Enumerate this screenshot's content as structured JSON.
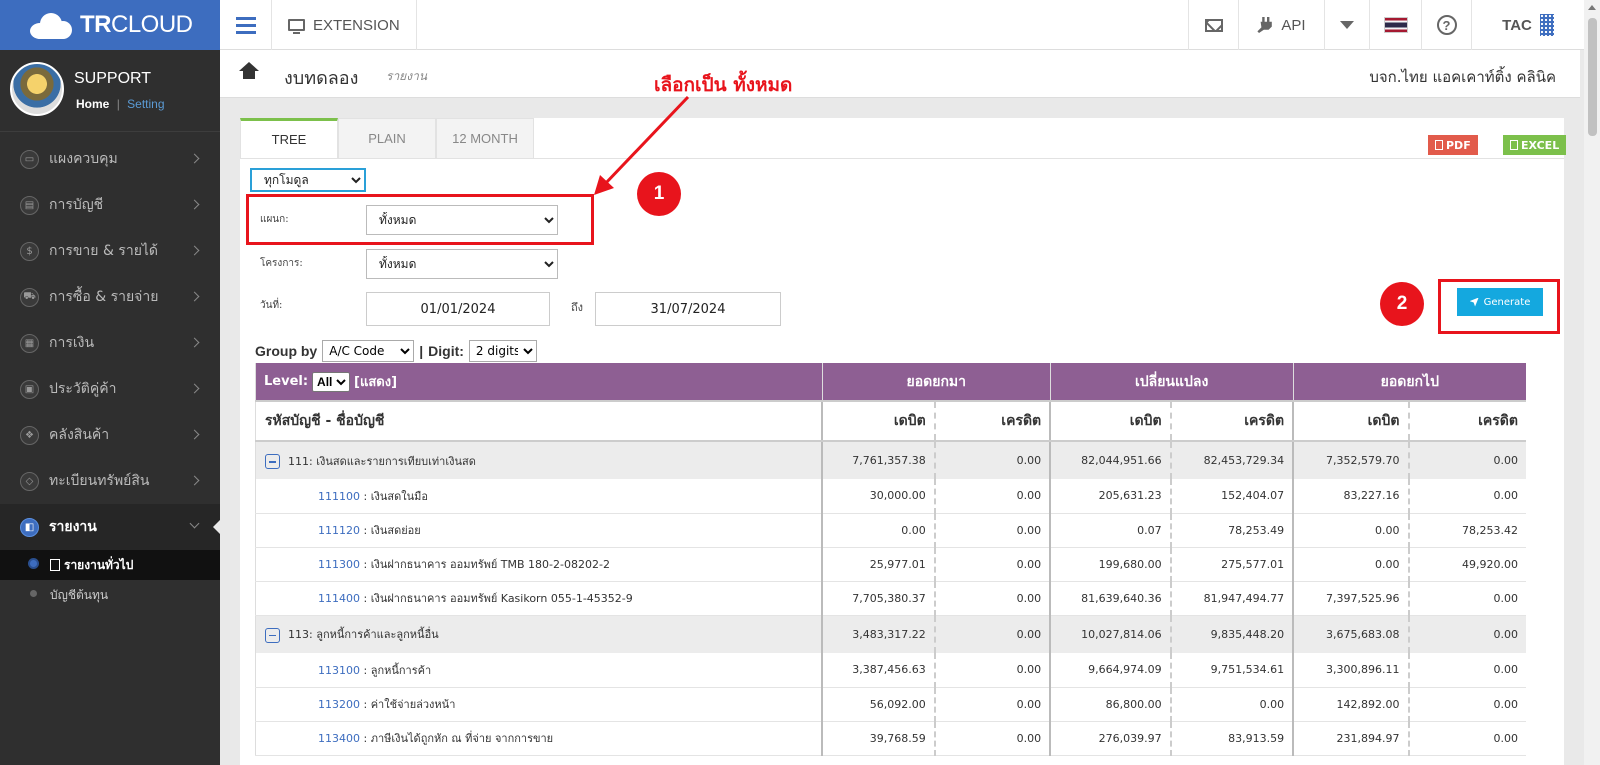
{
  "brand": {
    "logo_bold": "TR",
    "logo_rest": "CLOUD"
  },
  "topbar": {
    "extension_label": "EXTENSION",
    "api_label": "API",
    "user_code": "TAC"
  },
  "sidebar": {
    "user_name": "SUPPORT",
    "home_link": "Home",
    "separator": "|",
    "setting_link": "Setting",
    "items": [
      {
        "label": "แผงควบคุม",
        "icon": "monitor-icon",
        "glyph": "▭"
      },
      {
        "label": "การบัญชี",
        "icon": "book-icon",
        "glyph": "▤"
      },
      {
        "label": "การขาย & รายได้",
        "icon": "dollar-icon",
        "glyph": "$"
      },
      {
        "label": "การซื้อ & รายจ่าย",
        "icon": "cart-icon",
        "glyph": "⛟"
      },
      {
        "label": "การเงิน",
        "icon": "calendar-icon",
        "glyph": "▦"
      },
      {
        "label": "ประวัติคู่ค้า",
        "icon": "contact-icon",
        "glyph": "▣"
      },
      {
        "label": "คลังสินค้า",
        "icon": "cubes-icon",
        "glyph": "❖"
      },
      {
        "label": "ทะเบียนทรัพย์สิน",
        "icon": "diamond-icon",
        "glyph": "◇"
      },
      {
        "label": "รายงาน",
        "icon": "report-icon",
        "glyph": "◧",
        "active": true
      }
    ],
    "subitems": [
      {
        "label": "รายงานทั่วไป",
        "current": true
      },
      {
        "label": "บัญชีต้นทุน"
      }
    ]
  },
  "page": {
    "title": "งบทดลอง",
    "subtitle": "รายงาน",
    "company": "บจก.ไทย แอคเคาท์ติ้ง คลินิค"
  },
  "tabs": [
    {
      "label": "TREE",
      "active": true
    },
    {
      "label": "PLAIN"
    },
    {
      "label": "12 MONTH"
    }
  ],
  "export": {
    "pdf": "PDF",
    "excel": "EXCEL"
  },
  "filters": {
    "data_scope": "ทุกโมดูล",
    "department_label": "แผนก:",
    "department_value": "ทั้งหมด",
    "project_label": "โครงการ:",
    "project_value": "ทั้งหมด",
    "date_label": "วันที่:",
    "date_from": "01/01/2024",
    "to_label": "ถึง",
    "date_to": "31/07/2024",
    "generate": "Generate"
  },
  "grouping": {
    "group_by_label": "Group by",
    "group_by_value": "A/C Code",
    "separator": "|",
    "digit_label": "Digit:",
    "digit_value": "2 digits"
  },
  "report": {
    "level_label": "Level:",
    "level_value": "All",
    "show_label": "[แสดง]",
    "group_opening": "ยอดยกมา",
    "group_change": "เปลี่ยนแปลง",
    "group_closing": "ยอดยกไป",
    "col_account": "รหัสบัญชี - ชื่อบัญชี",
    "col_debit": "เดบิต",
    "col_credit": "เครดิต",
    "rows": [
      {
        "type": "group",
        "code": "111",
        "name": ": เงินสดและรายการเทียบเท่าเงินสด",
        "v": [
          "7,761,357.38",
          "0.00",
          "82,044,951.66",
          "82,453,729.34",
          "7,352,579.70",
          "0.00"
        ]
      },
      {
        "type": "detail",
        "code": "111100",
        "name": " : เงินสดในมือ",
        "v": [
          "30,000.00",
          "0.00",
          "205,631.23",
          "152,404.07",
          "83,227.16",
          "0.00"
        ]
      },
      {
        "type": "detail",
        "code": "111120",
        "name": " : เงินสดย่อย",
        "v": [
          "0.00",
          "0.00",
          "0.07",
          "78,253.49",
          "0.00",
          "78,253.42"
        ]
      },
      {
        "type": "detail",
        "code": "111300",
        "name": " : เงินฝากธนาคาร ออมทรัพย์ TMB 180-2-08202-2",
        "v": [
          "25,977.01",
          "0.00",
          "199,680.00",
          "275,577.01",
          "0.00",
          "49,920.00"
        ]
      },
      {
        "type": "detail",
        "code": "111400",
        "name": " : เงินฝากธนาคาร ออมทรัพย์ Kasikorn 055-1-45352-9",
        "v": [
          "7,705,380.37",
          "0.00",
          "81,639,640.36",
          "81,947,494.77",
          "7,397,525.96",
          "0.00"
        ]
      },
      {
        "type": "group",
        "code": "113",
        "name": ": ลูกหนี้การค้าและลูกหนี้อื่น",
        "v": [
          "3,483,317.22",
          "0.00",
          "10,027,814.06",
          "9,835,448.20",
          "3,675,683.08",
          "0.00"
        ]
      },
      {
        "type": "detail",
        "code": "113100",
        "name": " : ลูกหนี้การค้า",
        "v": [
          "3,387,456.63",
          "0.00",
          "9,664,974.09",
          "9,751,534.61",
          "3,300,896.11",
          "0.00"
        ]
      },
      {
        "type": "detail",
        "code": "113200",
        "name": " : ค่าใช้จ่ายล่วงหน้า",
        "v": [
          "56,092.00",
          "0.00",
          "86,800.00",
          "0.00",
          "142,892.00",
          "0.00"
        ]
      },
      {
        "type": "detail",
        "code": "113400",
        "name": " : ภาษีเงินได้ถูกหัก ณ ที่จ่าย จากการขาย",
        "v": [
          "39,768.59",
          "0.00",
          "276,039.97",
          "83,913.59",
          "231,894.97",
          "0.00"
        ]
      }
    ]
  },
  "annotations": {
    "instruction": "เลือกเป็น ทั้งหมด",
    "step1": "1",
    "step2": "2",
    "color": "#e8141c"
  },
  "colors": {
    "brand_blue": "#3d6dbf",
    "sidebar_bg": "#2f2f2f",
    "header_purple": "#8e5f93",
    "generate_blue": "#14a8df",
    "pdf_red": "#e25b4b",
    "excel_green": "#7cc04b"
  }
}
